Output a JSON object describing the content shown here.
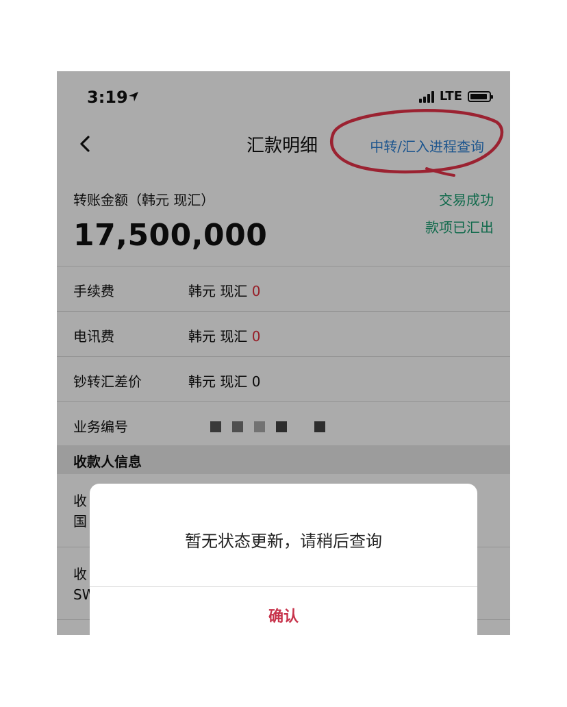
{
  "status_bar": {
    "time": "3:19",
    "network": "LTE",
    "location_icon": "location-arrow-icon",
    "signal_icon": "signal-bars-icon",
    "battery_icon": "battery-icon"
  },
  "nav": {
    "back_icon": "chevron-left-icon",
    "title": "汇款明细",
    "link": "中转/汇入进程查询"
  },
  "transfer": {
    "amount_label": "转账金额（韩元 现汇）",
    "amount": "17,500,000",
    "status_primary": "交易成功",
    "status_secondary": "款项已汇出"
  },
  "fees": [
    {
      "label": "手续费",
      "currency": "韩元 现汇 ",
      "value": "0"
    },
    {
      "label": "电讯费",
      "currency": "韩元 现汇 ",
      "value": "0"
    },
    {
      "label": "钞转汇差价",
      "currency": "韩元 现汇 ",
      "value": "0"
    }
  ],
  "business_no": {
    "label": "业务编号"
  },
  "payee": {
    "section_title": "收款人信息",
    "row1": {
      "label_fragment": "收",
      "value_fragment": "国"
    },
    "row2": {
      "label_fragment": "收",
      "value_fragment": "SW"
    }
  },
  "dialog": {
    "message": "暂无状态更新，请稍后查询",
    "confirm": "确认"
  },
  "colors": {
    "link_blue": "#2a7fd4",
    "success_green": "#1a9e72",
    "fee_red": "#e02f3c",
    "confirm_red": "#c7324a",
    "annotation_red": "#e8334a"
  }
}
